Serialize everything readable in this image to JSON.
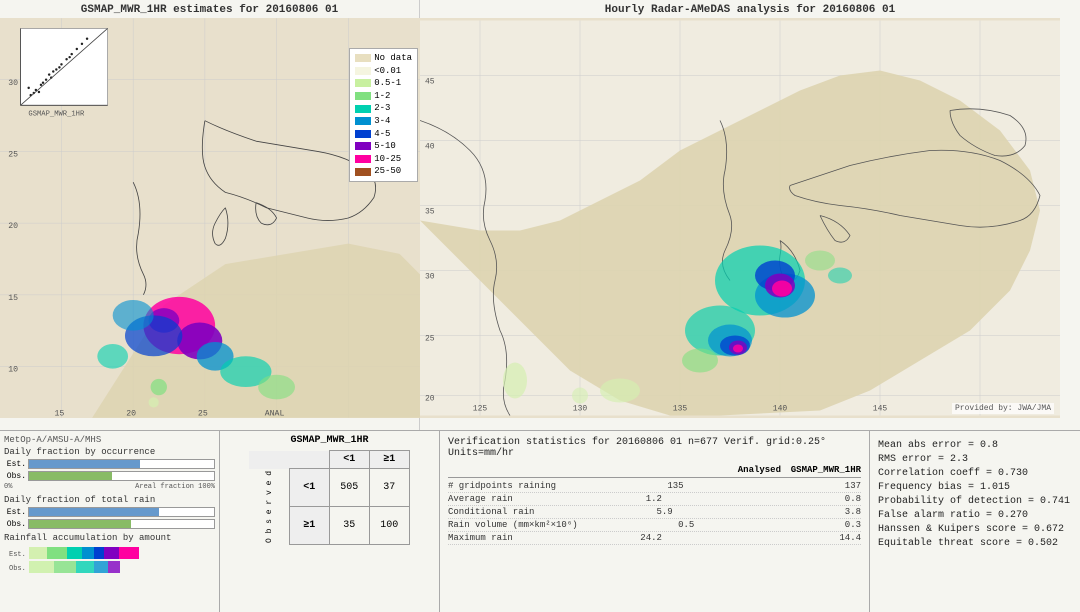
{
  "leftMap": {
    "title": "GSMAP_MWR_1HR estimates for 20160806 01",
    "subtitle": "MetOp-A/AMSU-A/MHS",
    "credit": "",
    "axisLabels": {
      "x": [
        "15",
        "20",
        "25"
      ],
      "y": [
        "10",
        "15",
        "20",
        "25"
      ]
    }
  },
  "rightMap": {
    "title": "Hourly Radar-AMeDAS analysis for 20160806 01",
    "credit": "Provided by: JWA/JMA",
    "axisLabels": {
      "x": [
        "125",
        "130",
        "135",
        "140",
        "145"
      ],
      "y": [
        "20",
        "25",
        "30",
        "35",
        "40",
        "45"
      ]
    }
  },
  "legend": {
    "title": "",
    "items": [
      {
        "label": "No data",
        "color": "#e8dfc0"
      },
      {
        "label": "<0.01",
        "color": "#f5f5e0"
      },
      {
        "label": "0.5-1",
        "color": "#d4f0b0"
      },
      {
        "label": "1-2",
        "color": "#80e080"
      },
      {
        "label": "2-3",
        "color": "#00d0b0"
      },
      {
        "label": "3-4",
        "color": "#0090d0"
      },
      {
        "label": "4-5",
        "color": "#0040d0"
      },
      {
        "label": "5-10",
        "color": "#8000c0"
      },
      {
        "label": "10-25",
        "color": "#ff00a0"
      },
      {
        "label": "25-50",
        "color": "#a05020"
      }
    ]
  },
  "histograms": {
    "occurrence": {
      "title": "Daily fraction by occurrence",
      "est_pct": 60,
      "obs_pct": 45
    },
    "rain": {
      "title": "Daily fraction of total rain",
      "est_pct": 70,
      "obs_pct": 55
    },
    "accumulation": {
      "title": "Rainfall accumulation by amount"
    },
    "axis_label": "0%",
    "axis_label_right": "Areal fraction 100%"
  },
  "contingency": {
    "title": "GSMAP_MWR_1HR",
    "col_header_1": "<1",
    "col_header_2": "≥1",
    "row_header_1": "<1",
    "row_header_2": "≥1",
    "obs_label": "O\nb\ns\ne\nr\nv\ne\nd",
    "cell_11": "505",
    "cell_12": "37",
    "cell_21": "35",
    "cell_22": "100"
  },
  "verif": {
    "title": "Verification statistics for 20160806 01  n=677  Verif. grid:0.25°  Units=mm/hr",
    "col_analyzed": "Analysed",
    "col_gsmap": "GSMAP_MWR_1HR",
    "rows": [
      {
        "name": "# gridpoints raining",
        "analyzed": "135",
        "gsmap": "137"
      },
      {
        "name": "Average rain",
        "analyzed": "1.2",
        "gsmap": "0.8"
      },
      {
        "name": "Conditional rain",
        "analyzed": "5.9",
        "gsmap": "3.8"
      },
      {
        "name": "Rain volume (mm×km²×10⁶)",
        "analyzed": "0.5",
        "gsmap": "0.3"
      },
      {
        "name": "Maximum rain",
        "analyzed": "24.2",
        "gsmap": "14.4"
      }
    ]
  },
  "metrics": {
    "lines": [
      "Mean abs error = 0.8",
      "RMS error = 2.3",
      "Correlation coeff = 0.730",
      "Frequency bias = 1.015",
      "Probability of detection = 0.741",
      "False alarm ratio = 0.270",
      "Hanssen & Kuipers score = 0.672",
      "Equitable threat score = 0.502"
    ]
  }
}
